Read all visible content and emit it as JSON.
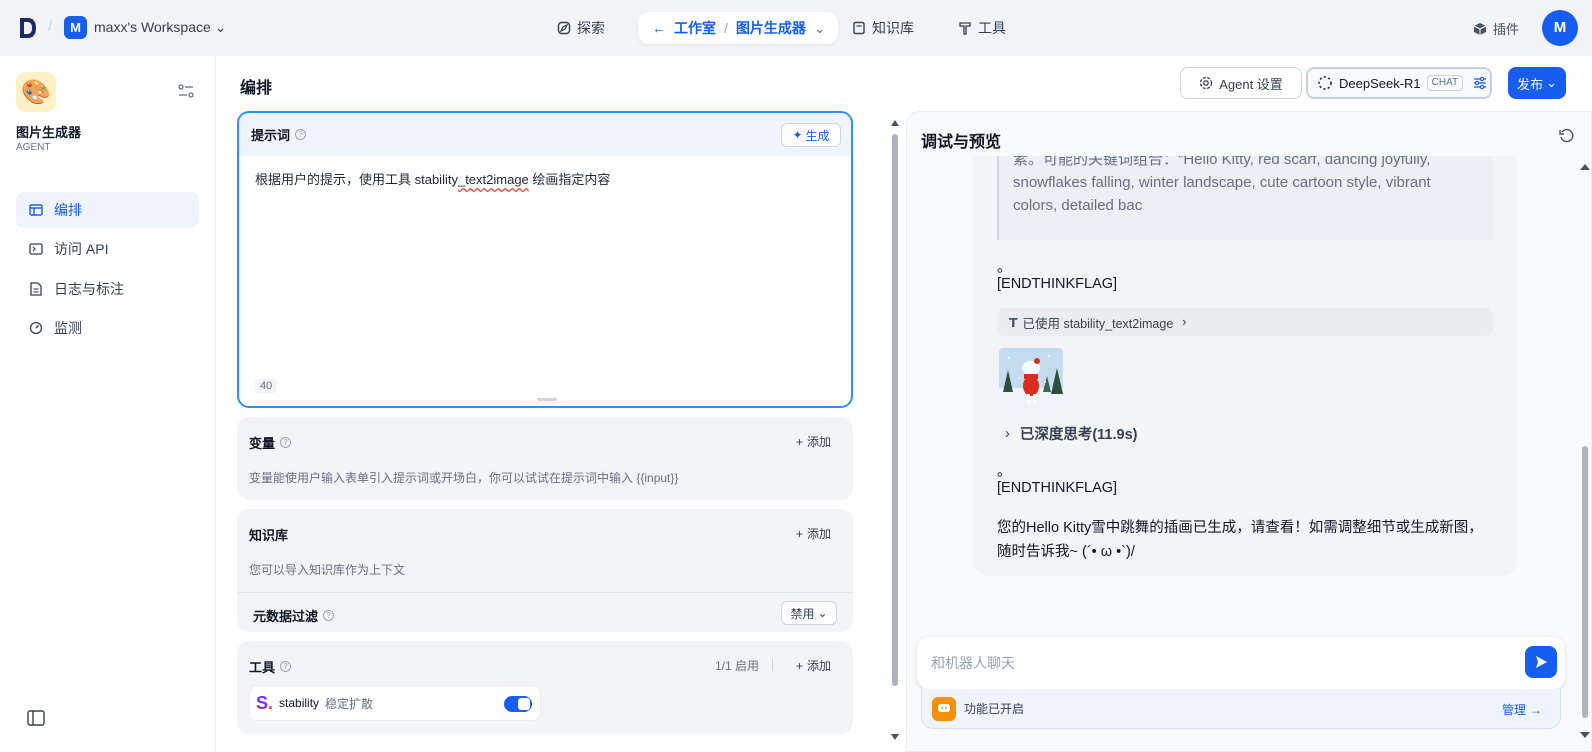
{
  "header": {
    "workspace_badge": "M",
    "workspace_name": "maxx's Workspace",
    "nav": {
      "explore": "探索",
      "studio": "工作室",
      "app_crumb": "图片生成器",
      "knowledge": "知识库",
      "tools": "工具"
    },
    "plugins": "插件",
    "avatar": "M"
  },
  "sidebar": {
    "app_name": "图片生成器",
    "app_type": "AGENT",
    "items": [
      {
        "label": "编排",
        "icon": "layout-icon",
        "active": true
      },
      {
        "label": "访问 API",
        "icon": "terminal-icon",
        "active": false
      },
      {
        "label": "日志与标注",
        "icon": "file-icon",
        "active": false
      },
      {
        "label": "监测",
        "icon": "gauge-icon",
        "active": false
      }
    ]
  },
  "orchestrate": {
    "title": "编排",
    "agent_settings": "Agent 设置",
    "model_name": "DeepSeek-R1",
    "model_mode": "CHAT",
    "publish": "发布"
  },
  "prompt": {
    "label": "提示词",
    "generate": "生成",
    "text_before": "根据用户的提示，使用工具 stability",
    "text_underlined": "_text2image",
    "text_after": " 绘画指定内容",
    "char_count": "40"
  },
  "variables": {
    "label": "变量",
    "add": "添加",
    "desc": "变量能使用户输入表单引入提示词或开场白，你可以试试在提示词中输入 {{input}}"
  },
  "knowledge": {
    "label": "知识库",
    "add": "添加",
    "desc": "您可以导入知识库作为上下文",
    "metadata_filter": "元数据过滤",
    "filter_value": "禁用"
  },
  "tools": {
    "label": "工具",
    "count": "1/1 启用",
    "add": "添加",
    "item_name": "stability",
    "item_desc": "稳定扩散",
    "enabled": true
  },
  "debug": {
    "title": "调试与预览",
    "quote_lines": [
      "素。可能的关键词组合：\"Hello Kitty, red scarf, dancing joyfully,",
      "snowflakes falling, winter landscape, cute cartoon style, vibrant",
      "colors, detailed bac"
    ],
    "dot1": "。",
    "flag1": "[ENDTHINKFLAG]",
    "tool_used": "已使用 stability_text2image",
    "thinking": "已深度思考(11.9s)",
    "dot2": "。",
    "flag2": "[ENDTHINKFLAG]",
    "final_reply": "您的Hello Kitty雪中跳舞的插画已生成，请查看！如需调整细节或生成新图，随时告诉我~ (´• ω •`)/",
    "input_placeholder": "和机器人聊天",
    "feature_status": "功能已开启",
    "manage": "管理"
  },
  "colors": {
    "accent": "#155eef",
    "prompt_border": "#2e90fa"
  }
}
